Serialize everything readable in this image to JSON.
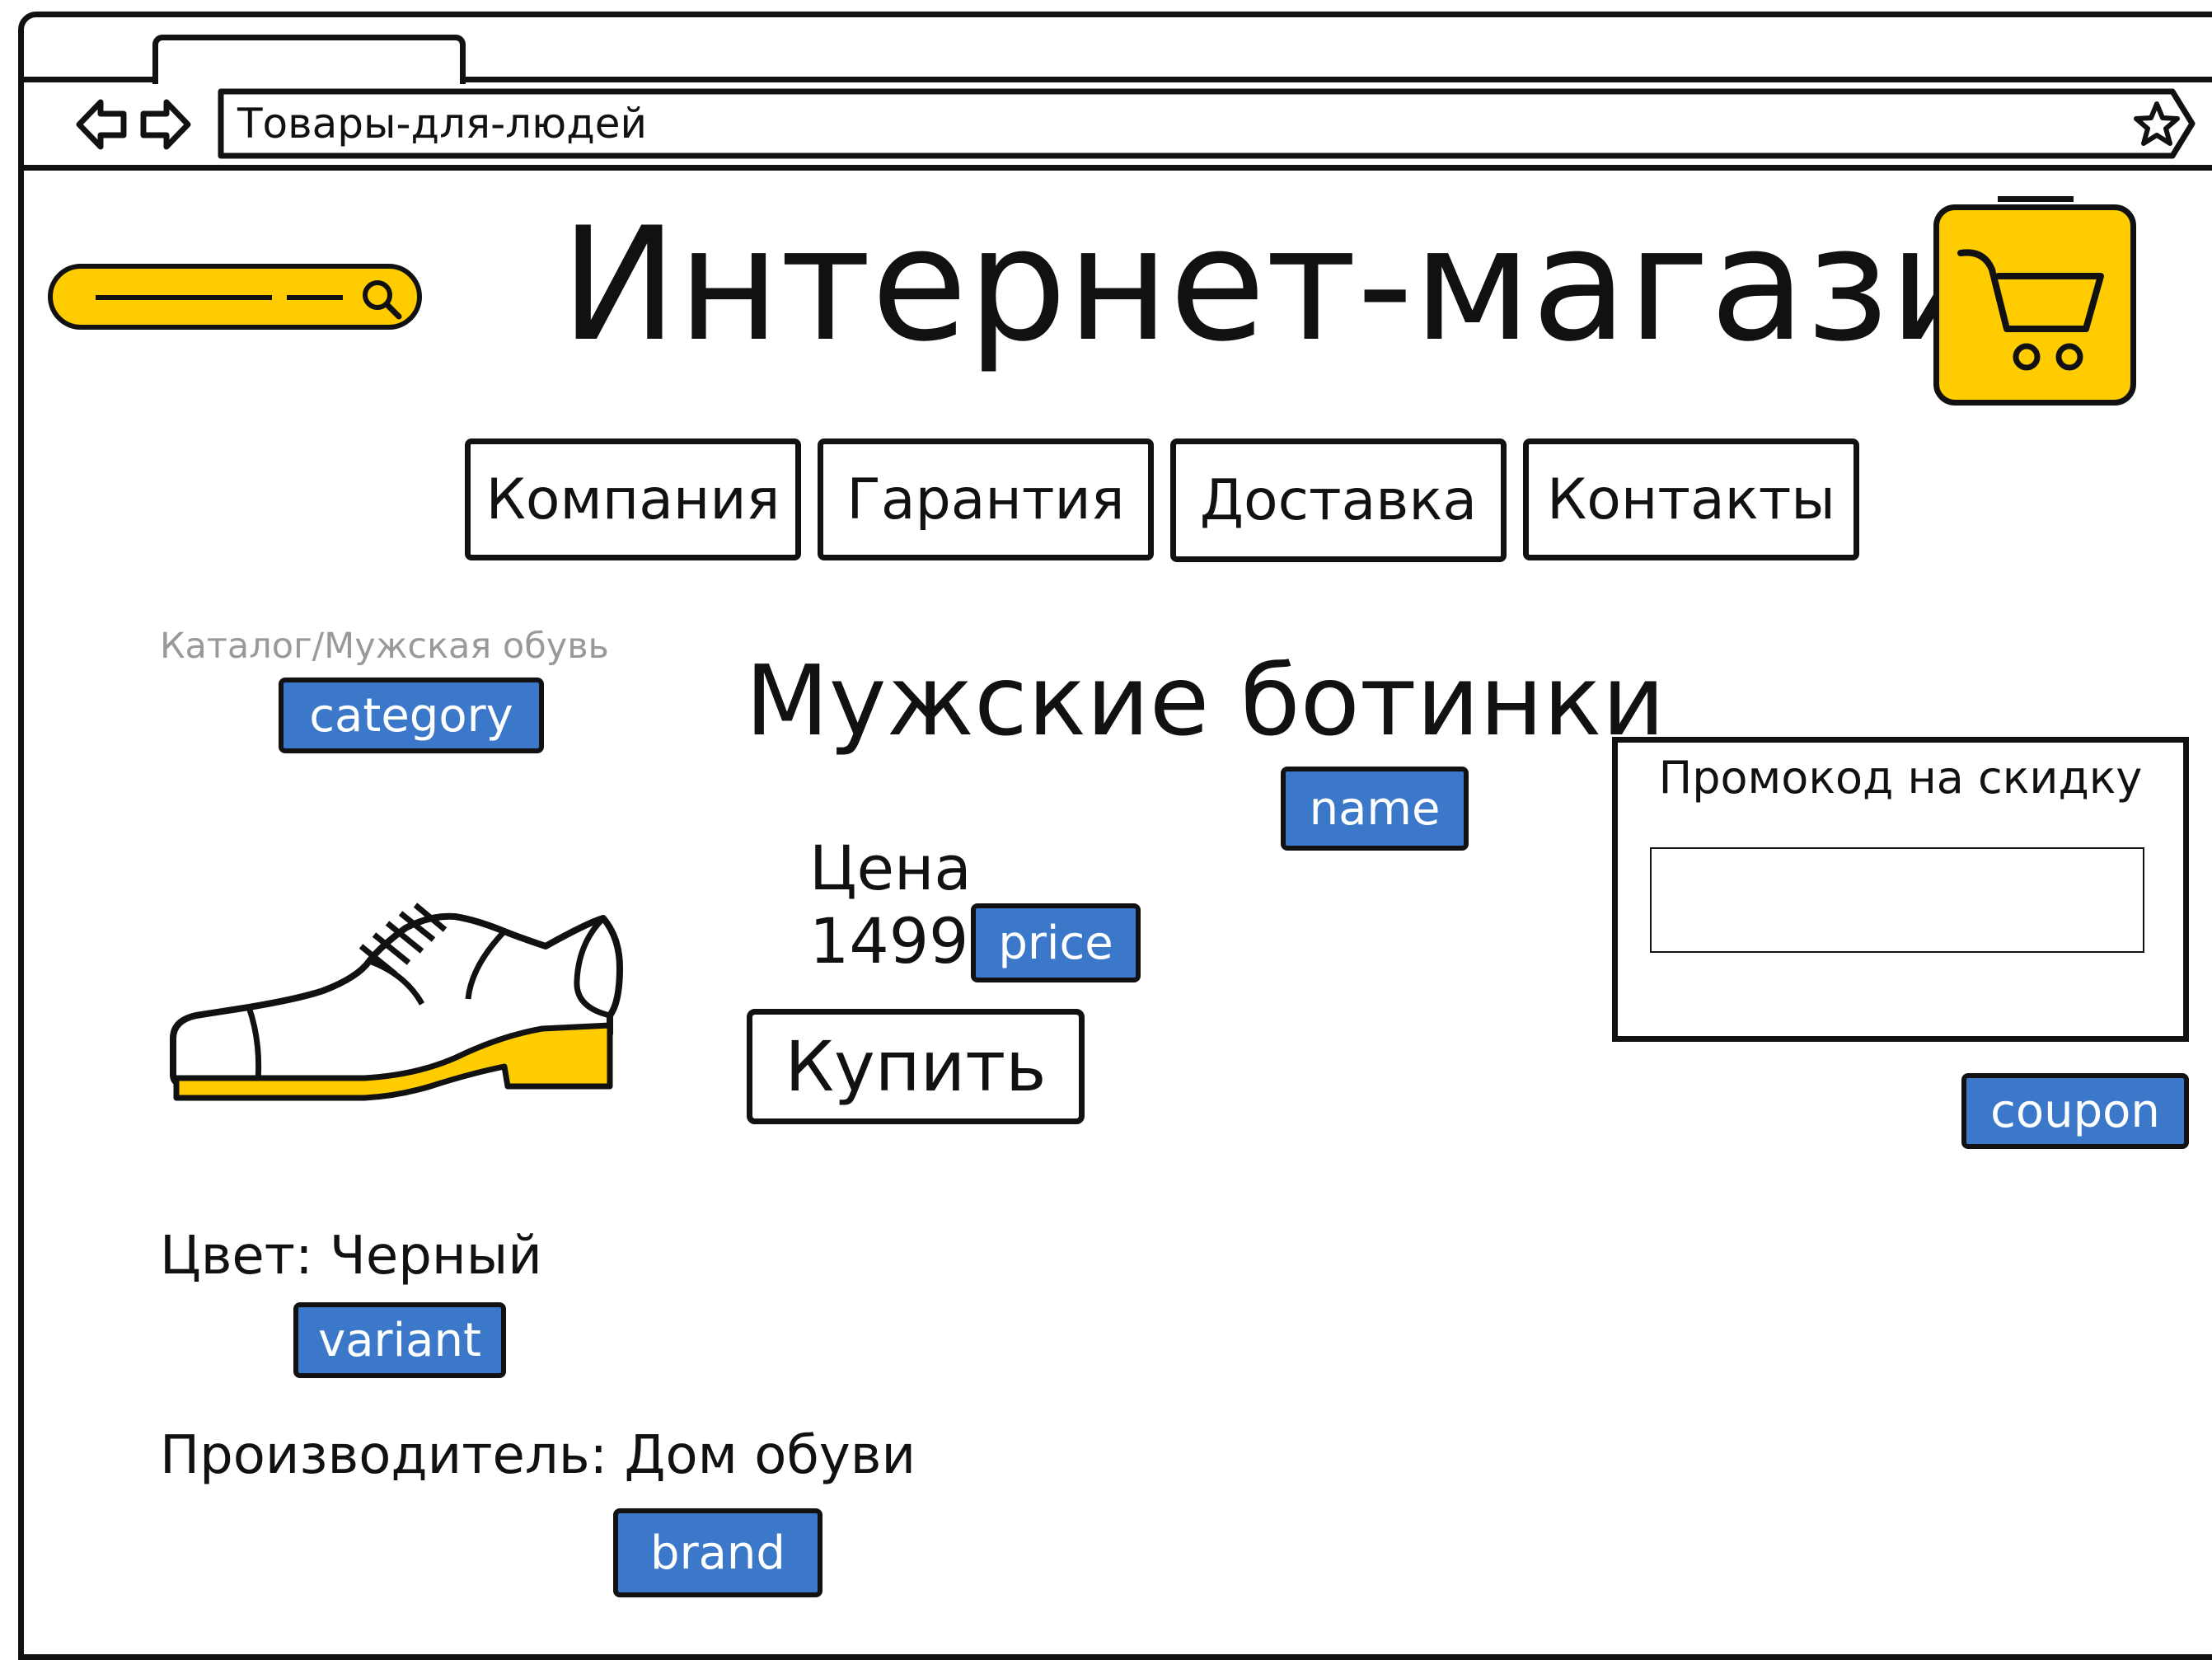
{
  "browser": {
    "address": "Товары-для-людей",
    "back_icon": "back-arrow-icon",
    "forward_icon": "forward-arrow-icon",
    "bookmark_icon": "star-icon"
  },
  "header": {
    "title": "Интернет-магазин",
    "search_icon": "search-icon",
    "cart_icon": "shopping-cart-icon",
    "accent_color": "#FFCC00"
  },
  "nav": {
    "items": [
      {
        "label": "Компания"
      },
      {
        "label": "Гарантия"
      },
      {
        "label": "Доставка"
      },
      {
        "label": "Контакты"
      }
    ]
  },
  "breadcrumb": "Каталог/Мужская обувь",
  "product": {
    "name": "Мужские ботинки",
    "price_label": "Цена",
    "price": "1499",
    "buy_label": "Купить",
    "color_text": "Цвет: Черный",
    "manufacturer_text": "Производитель: Дом обуви",
    "image_icon": "shoe-icon"
  },
  "coupon": {
    "label": "Промокод на скидку",
    "value": ""
  },
  "tags": {
    "category": "category",
    "name": "name",
    "price": "price",
    "coupon": "coupon",
    "variant": "variant",
    "brand": "brand",
    "color": "#3B78C9"
  }
}
